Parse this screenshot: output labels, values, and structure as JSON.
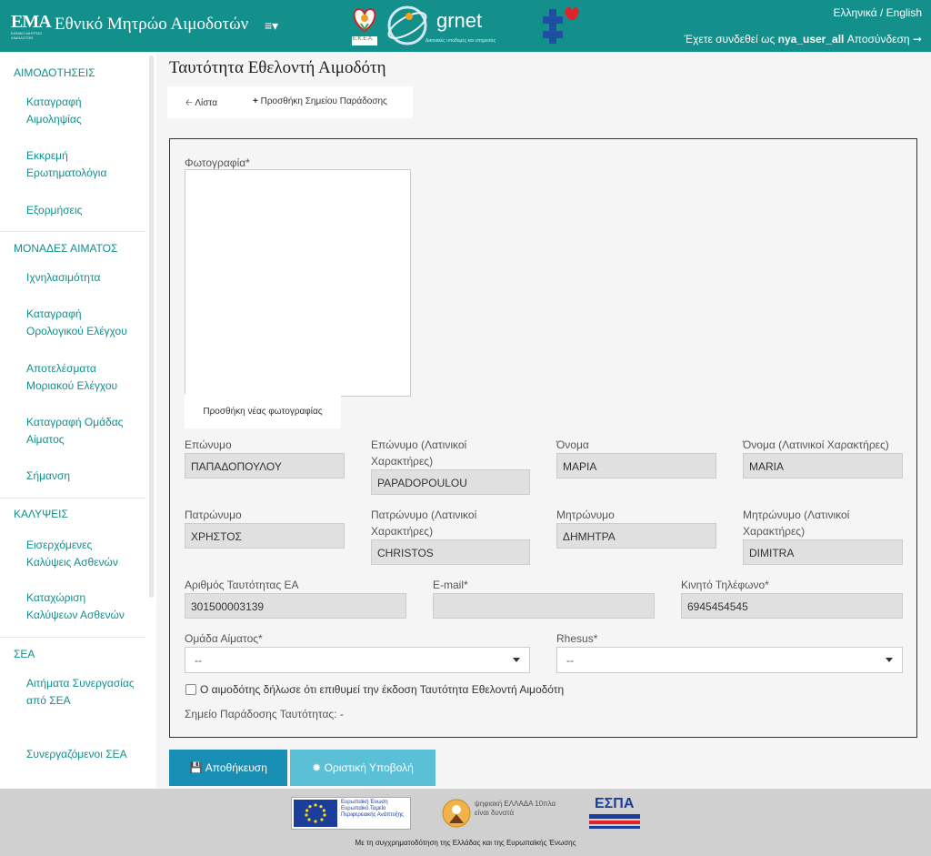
{
  "header": {
    "logo_text": "ΕΜΑ",
    "logo_sub": "ΕΘΝΙΚΟ ΜΗΤΡΩΟ ΑΙΜΟΔΟΤΩΝ",
    "title": "Εθνικό Μητρώο Αιμοδοτών",
    "menu_icon": "≡▾",
    "partner_logo_1": "Ε.Κ.Ε.Α.",
    "partner_logo_2": "grnet",
    "partner_logo_2_sub": "Δικτυακές υποδομές και υπηρεσίες",
    "language": "Ελληνικά / English",
    "logged_in_prefix": "Έχετε συνδεθεί ως",
    "username": "nya_user_all",
    "logout": "Αποσύνδεση"
  },
  "sidebar": {
    "sections": [
      {
        "title": "ΑΙΜΟΔΟΤΗΣΕΙΣ",
        "items": [
          "Καταγραφή Αιμοληψίας",
          "Εκκρεμή Ερωτηματολόγια",
          "Εξορμήσεις"
        ]
      },
      {
        "title": "ΜΟΝΑΔΕΣ ΑΙΜΑΤΟΣ",
        "items": [
          "Ιχνηλασιμότητα",
          "Καταγραφή Ορολογικού Ελέγχου",
          "Αποτελέσματα Μοριακού Ελέγχου",
          "Καταγραφή Ομάδας Αίματος",
          "Σήμανση"
        ]
      },
      {
        "title": "ΚΑΛΥΨΕΙΣ",
        "items": [
          "Εισερχόμενες Καλύψεις Ασθενών",
          "Καταχώριση Καλύψεων Ασθενών"
        ]
      },
      {
        "title": "ΣΕΑ",
        "items": [
          "Αιτήματα Συνεργασίας από ΣΕΑ",
          "Συνεργαζόμενοι ΣΕΑ"
        ]
      }
    ]
  },
  "main": {
    "title": "Ταυτότητα Εθελοντή Αιμοδότη",
    "toolbar": {
      "list": "Λίστα",
      "add_point": "Προσθήκη Σημείου Παράδοσης"
    },
    "photo_label": "Φωτογραφία*",
    "photo_button": "Προσθήκη νέας φωτογραφίας",
    "fields": {
      "surname": {
        "label": "Επώνυμο",
        "value": "ΠΑΠΑΔΟΠΟΥΛΟΥ"
      },
      "surname_latin": {
        "label": "Επώνυμο (Λατινικοί Χαρακτήρες)",
        "value": "PAPADOPOULOU"
      },
      "name": {
        "label": "Όνομα",
        "value": "ΜΑΡΙΑ"
      },
      "name_latin": {
        "label": "Όνομα (Λατινικοί Χαρακτήρες)",
        "value": "MARIA"
      },
      "father": {
        "label": "Πατρώνυμο",
        "value": "ΧΡΗΣΤΟΣ"
      },
      "father_latin": {
        "label": "Πατρώνυμο (Λατινικοί Χαρακτήρες)",
        "value": "CHRISTOS"
      },
      "mother": {
        "label": "Μητρώνυμο",
        "value": "ΔΗΜΗΤΡΑ"
      },
      "mother_latin": {
        "label": "Μητρώνυμο (Λατινικοί Χαρακτήρες)",
        "value": "DIMITRA"
      },
      "id_number": {
        "label": "Αριθμός Ταυτότητας ΕΑ",
        "value": "301500003139"
      },
      "email": {
        "label": "E-mail*",
        "value": ""
      },
      "mobile": {
        "label": "Κινητό Τηλέφωνο*",
        "value": "6945454545"
      },
      "blood_group": {
        "label": "Ομάδα Αίματος*",
        "value": "--"
      },
      "rhesus": {
        "label": "Rhesus*",
        "value": "--"
      }
    },
    "checkbox_label": "Ο αιμοδότης δήλωσε ότι επιθυμεί την έκδοση Ταυτότητα Εθελοντή Αιμοδότη",
    "delivery_point": "Σημείο Παράδοσης Ταυτότητας: -",
    "save_button": "Αποθήκευση",
    "submit_button": "Οριστική Υποβολή"
  },
  "footer": {
    "eu_text": "Ευρωπαϊκή Ένωση Ευρωπαϊκό Ταμείο Περιφερειακής Ανάπτυξης",
    "digital_text": "ψηφιακή ΕΛΛΑΔΑ 10πλα είναι δυνατά",
    "espa_text": "ΕΣΠΑ",
    "cofinance": "Με τη συγχρηματοδότηση της Ελλάδας και της Ευρωπαϊκής Ένωσης"
  }
}
